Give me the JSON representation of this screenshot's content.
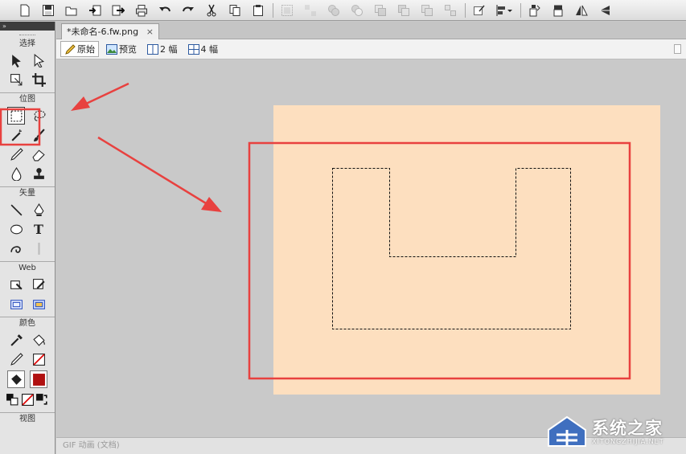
{
  "toolbar": {
    "buttons": [
      "new-icon",
      "save-icon",
      "open-icon",
      "import-icon",
      "export-icon",
      "print-icon",
      "undo-icon",
      "redo-icon",
      "cut-icon",
      "copy-icon",
      "paste-icon",
      "group-icon",
      "ungroup-icon",
      "union-icon",
      "punch-icon",
      "intersect-icon",
      "crop-icon",
      "combine-icon",
      "insert-icon",
      "align-icon",
      "rotate-icon",
      "rotate-cw-icon",
      "flip-h-icon",
      "flip-v-icon"
    ]
  },
  "tools_panel": {
    "header_glyph": "»",
    "sections": {
      "select": "选择",
      "bitmap": "位图",
      "vector": "矢量",
      "web": "Web",
      "colors": "颜色",
      "view": "视图"
    },
    "text_tool_glyph": "T"
  },
  "document": {
    "tab_title": "*未命名-6.fw.png",
    "close_glyph": "×"
  },
  "view_modes": {
    "original": "原始",
    "preview": "预览",
    "two_up": "2 幅",
    "four_up": "4 幅"
  },
  "colors": {
    "canvas": "#fddfbf",
    "highlight": "#e8413f",
    "fill_swatch": "#b01010"
  },
  "status_bar": {
    "text": "GIF 动画 (文档)"
  },
  "watermark": {
    "main": "系统之家",
    "sub": "XITONGZHIJIA.NET"
  }
}
